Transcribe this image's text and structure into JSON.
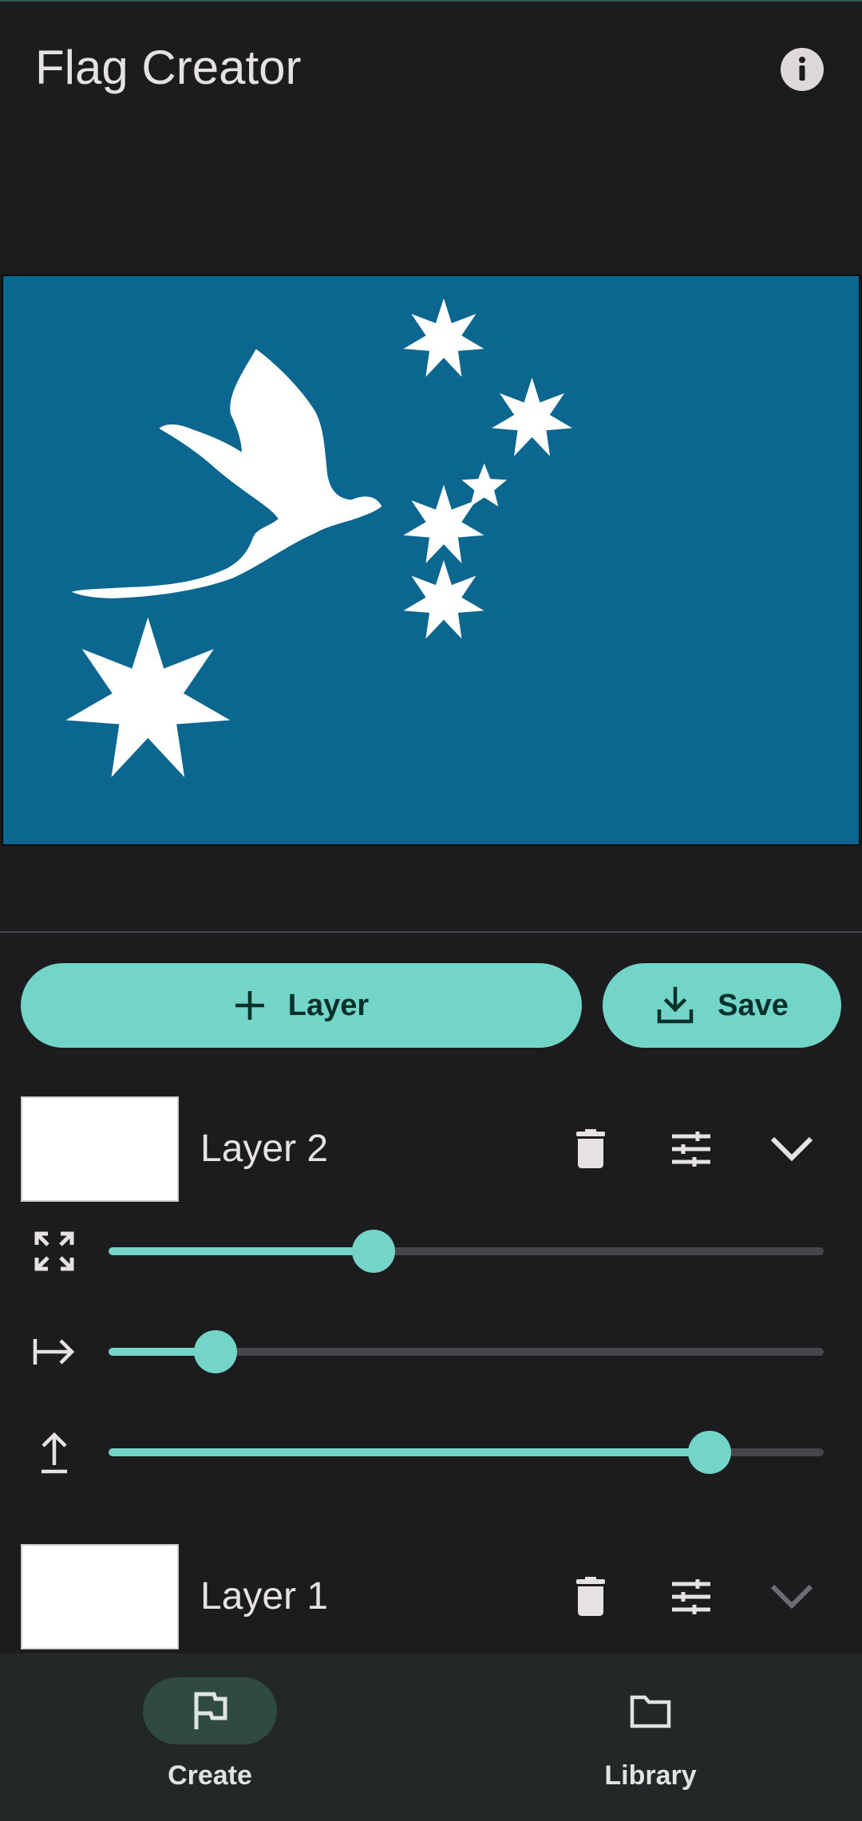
{
  "app": {
    "title": "Flag Creator"
  },
  "icons": {
    "info": "info-icon",
    "add": "plus-icon",
    "save": "download-icon",
    "delete": "trash-icon",
    "adjust": "tune-icon",
    "expand": "chevron-down-icon",
    "size": "resize-icon",
    "horizontal": "arrow-right-icon",
    "vertical": "arrow-up-icon",
    "create": "flag-icon",
    "library": "folder-icon"
  },
  "colors": {
    "accent": "#72d5c7",
    "flag_background": "#0b6690",
    "flag_emblem": "#ffffff",
    "background": "#1c1b1e",
    "nav_background": "#222828"
  },
  "actions": {
    "add_layer_label": "Layer",
    "save_label": "Save"
  },
  "layers": [
    {
      "name": "Layer 2",
      "expanded": true,
      "sliders": {
        "size": 0.37,
        "horizontal": 0.15,
        "vertical": 0.84
      }
    },
    {
      "name": "Layer 1",
      "expanded": false
    }
  ],
  "nav": {
    "items": [
      {
        "label": "Create",
        "active": true
      },
      {
        "label": "Library",
        "active": false
      }
    ]
  }
}
